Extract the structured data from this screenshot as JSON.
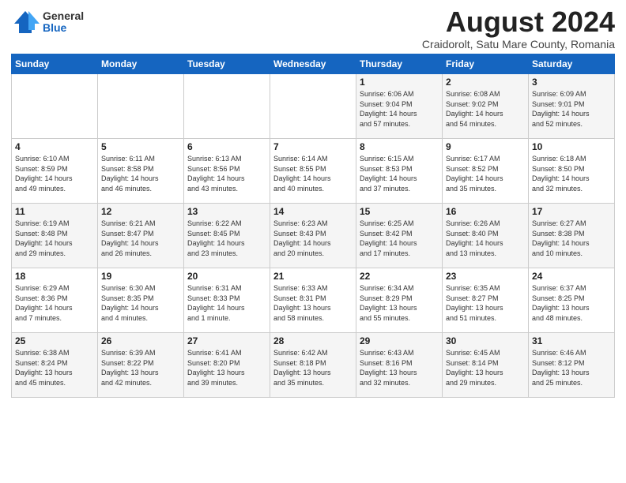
{
  "header": {
    "logo_general": "General",
    "logo_blue": "Blue",
    "month_title": "August 2024",
    "subtitle": "Craidorolt, Satu Mare County, Romania"
  },
  "calendar": {
    "days_of_week": [
      "Sunday",
      "Monday",
      "Tuesday",
      "Wednesday",
      "Thursday",
      "Friday",
      "Saturday"
    ],
    "weeks": [
      [
        {
          "day": "",
          "info": ""
        },
        {
          "day": "",
          "info": ""
        },
        {
          "day": "",
          "info": ""
        },
        {
          "day": "",
          "info": ""
        },
        {
          "day": "1",
          "info": "Sunrise: 6:06 AM\nSunset: 9:04 PM\nDaylight: 14 hours\nand 57 minutes."
        },
        {
          "day": "2",
          "info": "Sunrise: 6:08 AM\nSunset: 9:02 PM\nDaylight: 14 hours\nand 54 minutes."
        },
        {
          "day": "3",
          "info": "Sunrise: 6:09 AM\nSunset: 9:01 PM\nDaylight: 14 hours\nand 52 minutes."
        }
      ],
      [
        {
          "day": "4",
          "info": "Sunrise: 6:10 AM\nSunset: 8:59 PM\nDaylight: 14 hours\nand 49 minutes."
        },
        {
          "day": "5",
          "info": "Sunrise: 6:11 AM\nSunset: 8:58 PM\nDaylight: 14 hours\nand 46 minutes."
        },
        {
          "day": "6",
          "info": "Sunrise: 6:13 AM\nSunset: 8:56 PM\nDaylight: 14 hours\nand 43 minutes."
        },
        {
          "day": "7",
          "info": "Sunrise: 6:14 AM\nSunset: 8:55 PM\nDaylight: 14 hours\nand 40 minutes."
        },
        {
          "day": "8",
          "info": "Sunrise: 6:15 AM\nSunset: 8:53 PM\nDaylight: 14 hours\nand 37 minutes."
        },
        {
          "day": "9",
          "info": "Sunrise: 6:17 AM\nSunset: 8:52 PM\nDaylight: 14 hours\nand 35 minutes."
        },
        {
          "day": "10",
          "info": "Sunrise: 6:18 AM\nSunset: 8:50 PM\nDaylight: 14 hours\nand 32 minutes."
        }
      ],
      [
        {
          "day": "11",
          "info": "Sunrise: 6:19 AM\nSunset: 8:48 PM\nDaylight: 14 hours\nand 29 minutes."
        },
        {
          "day": "12",
          "info": "Sunrise: 6:21 AM\nSunset: 8:47 PM\nDaylight: 14 hours\nand 26 minutes."
        },
        {
          "day": "13",
          "info": "Sunrise: 6:22 AM\nSunset: 8:45 PM\nDaylight: 14 hours\nand 23 minutes."
        },
        {
          "day": "14",
          "info": "Sunrise: 6:23 AM\nSunset: 8:43 PM\nDaylight: 14 hours\nand 20 minutes."
        },
        {
          "day": "15",
          "info": "Sunrise: 6:25 AM\nSunset: 8:42 PM\nDaylight: 14 hours\nand 17 minutes."
        },
        {
          "day": "16",
          "info": "Sunrise: 6:26 AM\nSunset: 8:40 PM\nDaylight: 14 hours\nand 13 minutes."
        },
        {
          "day": "17",
          "info": "Sunrise: 6:27 AM\nSunset: 8:38 PM\nDaylight: 14 hours\nand 10 minutes."
        }
      ],
      [
        {
          "day": "18",
          "info": "Sunrise: 6:29 AM\nSunset: 8:36 PM\nDaylight: 14 hours\nand 7 minutes."
        },
        {
          "day": "19",
          "info": "Sunrise: 6:30 AM\nSunset: 8:35 PM\nDaylight: 14 hours\nand 4 minutes."
        },
        {
          "day": "20",
          "info": "Sunrise: 6:31 AM\nSunset: 8:33 PM\nDaylight: 14 hours\nand 1 minute."
        },
        {
          "day": "21",
          "info": "Sunrise: 6:33 AM\nSunset: 8:31 PM\nDaylight: 13 hours\nand 58 minutes."
        },
        {
          "day": "22",
          "info": "Sunrise: 6:34 AM\nSunset: 8:29 PM\nDaylight: 13 hours\nand 55 minutes."
        },
        {
          "day": "23",
          "info": "Sunrise: 6:35 AM\nSunset: 8:27 PM\nDaylight: 13 hours\nand 51 minutes."
        },
        {
          "day": "24",
          "info": "Sunrise: 6:37 AM\nSunset: 8:25 PM\nDaylight: 13 hours\nand 48 minutes."
        }
      ],
      [
        {
          "day": "25",
          "info": "Sunrise: 6:38 AM\nSunset: 8:24 PM\nDaylight: 13 hours\nand 45 minutes."
        },
        {
          "day": "26",
          "info": "Sunrise: 6:39 AM\nSunset: 8:22 PM\nDaylight: 13 hours\nand 42 minutes."
        },
        {
          "day": "27",
          "info": "Sunrise: 6:41 AM\nSunset: 8:20 PM\nDaylight: 13 hours\nand 39 minutes."
        },
        {
          "day": "28",
          "info": "Sunrise: 6:42 AM\nSunset: 8:18 PM\nDaylight: 13 hours\nand 35 minutes."
        },
        {
          "day": "29",
          "info": "Sunrise: 6:43 AM\nSunset: 8:16 PM\nDaylight: 13 hours\nand 32 minutes."
        },
        {
          "day": "30",
          "info": "Sunrise: 6:45 AM\nSunset: 8:14 PM\nDaylight: 13 hours\nand 29 minutes."
        },
        {
          "day": "31",
          "info": "Sunrise: 6:46 AM\nSunset: 8:12 PM\nDaylight: 13 hours\nand 25 minutes."
        }
      ]
    ]
  }
}
